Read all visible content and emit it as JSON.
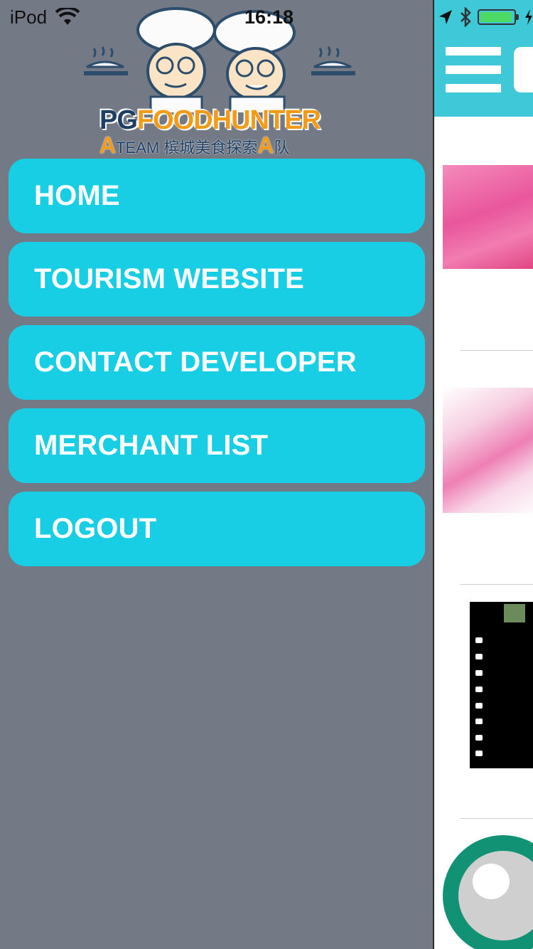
{
  "status_bar": {
    "carrier": "iPod",
    "time": "16:18"
  },
  "logo": {
    "title_left": "PG",
    "title_right": "FOODHUNTER",
    "subtitle_prefix": "A",
    "subtitle_team": "TEAM",
    "subtitle_chinese": "槟城美食探索",
    "subtitle_a": "A",
    "subtitle_suffix": "队"
  },
  "menu": {
    "items": [
      {
        "label": "HOME"
      },
      {
        "label": "TOURISM WEBSITE"
      },
      {
        "label": "CONTACT DEVELOPER"
      },
      {
        "label": "MERCHANT LIST"
      },
      {
        "label": "LOGOUT"
      }
    ]
  },
  "colors": {
    "drawer_bg": "#737a85",
    "menu_button": "#18cee4",
    "top_bar": "#3fc8d7"
  }
}
